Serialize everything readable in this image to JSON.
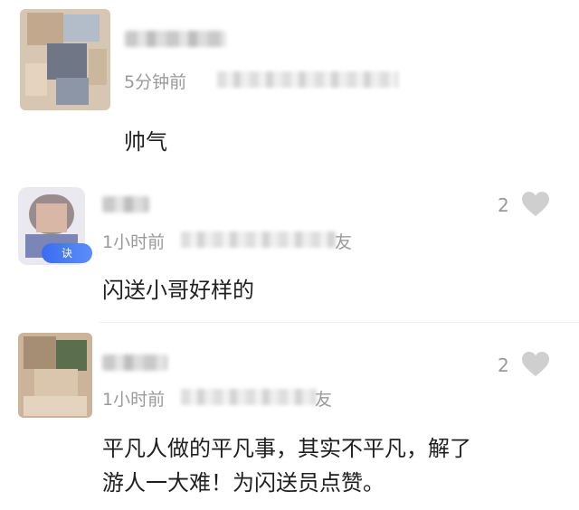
{
  "comments": [
    {
      "time": "5分钟前",
      "location_tail": "",
      "text_lines": [
        "帅气"
      ],
      "likes": ""
    },
    {
      "time": "1小时前",
      "location_tail": "友",
      "text_lines": [
        "闪送小哥好样的"
      ],
      "likes": "2",
      "badge_text": "诀"
    },
    {
      "time": "1小时前",
      "location_tail": "友",
      "text_lines": [
        "平凡人做的平凡事，其实不平凡，解了",
        "游人一大难！为闪送员点赞。"
      ],
      "likes": "2"
    }
  ],
  "colors": {
    "meta_text": "#9a9a9a",
    "body_text": "#1f1f1f",
    "heart": "#cfcfcf",
    "badge": "#3b6cf0"
  },
  "icons": {
    "like": "heart-icon"
  }
}
